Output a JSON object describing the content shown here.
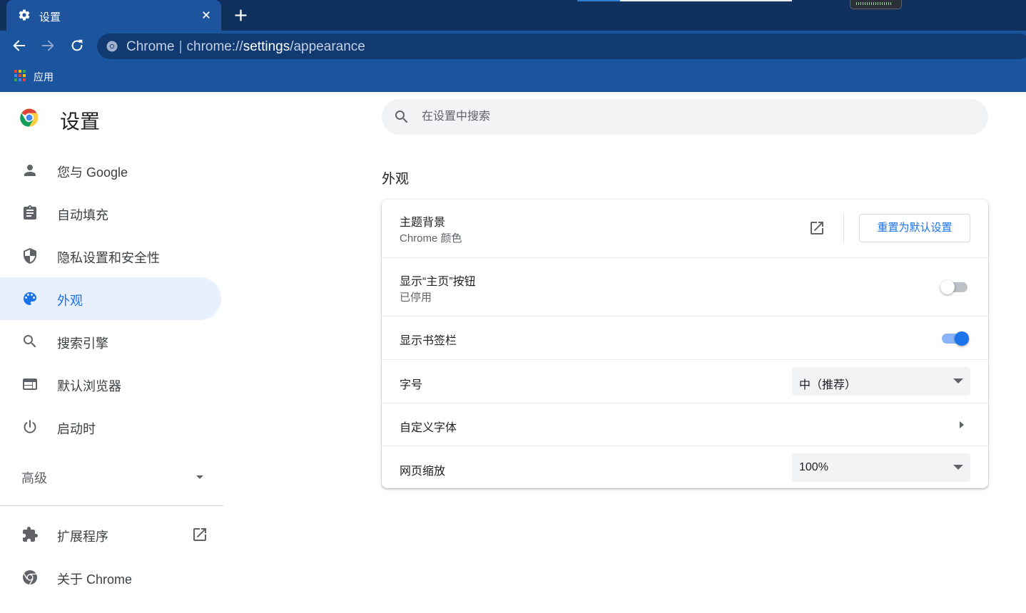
{
  "browser": {
    "tab_title": "设置",
    "tab_icon": "gear-icon",
    "url_site_label": "Chrome",
    "url_scheme": "chrome://",
    "url_host": "settings",
    "url_path": "/appearance",
    "bookmarks": [
      {
        "label": "应用",
        "icon": "apps-grid-icon"
      }
    ],
    "colors": {
      "tabstrip": "#10305e",
      "toolbar": "#1b559e",
      "omnibox": "#113a72"
    }
  },
  "page": {
    "title": "设置",
    "search_placeholder": "在设置中搜索",
    "section_title": "外观"
  },
  "sidebar": {
    "items": [
      {
        "label": "您与 Google",
        "icon": "person-icon",
        "active": false
      },
      {
        "label": "自动填充",
        "icon": "clipboard-icon",
        "active": false
      },
      {
        "label": "隐私设置和安全性",
        "icon": "shield-icon",
        "active": false
      },
      {
        "label": "外观",
        "icon": "palette-icon",
        "active": true
      },
      {
        "label": "搜索引擎",
        "icon": "search-icon",
        "active": false
      },
      {
        "label": "默认浏览器",
        "icon": "browser-window-icon",
        "active": false
      },
      {
        "label": "启动时",
        "icon": "power-icon",
        "active": false
      }
    ],
    "advanced_label": "高级",
    "bottom_items": [
      {
        "label": "扩展程序",
        "icon": "puzzle-icon"
      },
      {
        "label": "关于 Chrome",
        "icon": "chrome-logo-icon"
      }
    ]
  },
  "appearance": {
    "theme": {
      "label": "主题背景",
      "value": "Chrome 颜色",
      "reset_button": "重置为默认设置"
    },
    "home_button": {
      "label": "显示“主页”按钮",
      "status": "已停用",
      "enabled": false
    },
    "bookmarks_bar": {
      "label": "显示书签栏",
      "enabled": true
    },
    "font_size": {
      "label": "字号",
      "selected": "中（推荐）"
    },
    "custom_fonts": {
      "label": "自定义字体"
    },
    "page_zoom": {
      "label": "网页缩放",
      "selected": "100%"
    },
    "accent_color": "#1a73e8"
  }
}
